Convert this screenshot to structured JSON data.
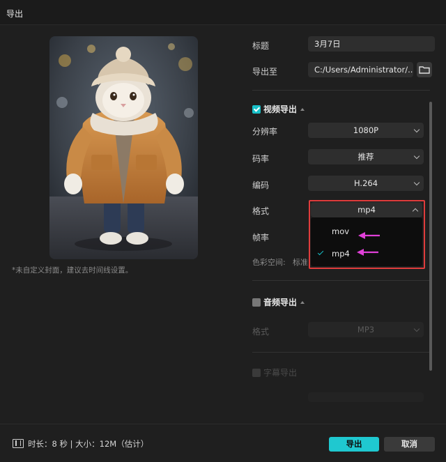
{
  "window": {
    "title": "导出"
  },
  "cover": {
    "note": "*未自定义封面，建议去时间线设置。"
  },
  "form": {
    "title_label": "标题",
    "title_value": "3月7日",
    "export_to_label": "导出至",
    "export_to_value": "C:/Users/Administrator/...",
    "folder_icon": "folder-icon"
  },
  "video_export": {
    "header": "视频导出",
    "checked": true,
    "resolution_label": "分辨率",
    "resolution_value": "1080P",
    "bitrate_label": "码率",
    "bitrate_value": "推荐",
    "codec_label": "编码",
    "codec_value": "H.264",
    "format_label": "格式",
    "format_value": "mp4",
    "framerate_label": "帧率",
    "colorspace_label": "色彩空间:",
    "colorspace_value": "标准",
    "format_options": [
      {
        "label": "mov",
        "selected": false
      },
      {
        "label": "mp4",
        "selected": true
      }
    ]
  },
  "audio_export": {
    "header": "音频导出",
    "checked": false,
    "format_label": "格式",
    "format_value": "MP3"
  },
  "subtitle_export": {
    "header": "字幕导出",
    "checked": false
  },
  "footer": {
    "info": "时长：8 秒 | 大小：12M（估计）",
    "export_button": "导出",
    "cancel_button": "取消"
  },
  "colors": {
    "accent": "#1fc8d0",
    "highlight_border": "#e03c3c",
    "annotation_arrow": "#e040d8"
  }
}
